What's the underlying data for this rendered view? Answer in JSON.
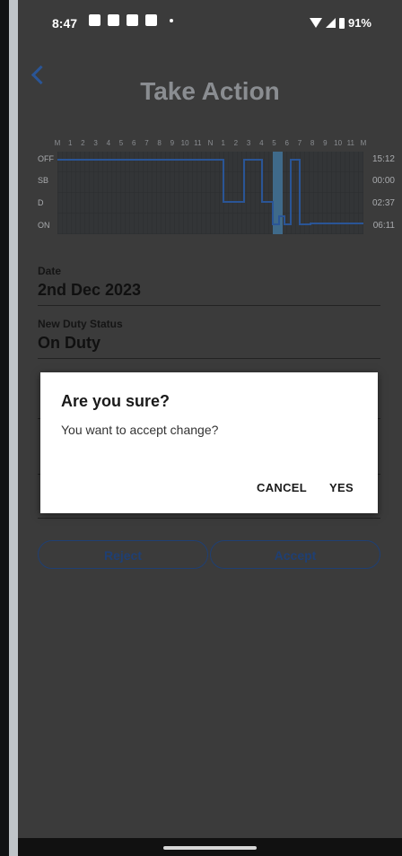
{
  "status_bar": {
    "time": "8:47",
    "battery": "91%",
    "notification_icons": [
      "teams-icon",
      "message-icon",
      "linkedin-icon",
      "nav-icon",
      "dot-icon"
    ]
  },
  "header": {
    "title": "Take Action"
  },
  "log_graph": {
    "hours": [
      "M",
      "1",
      "2",
      "3",
      "4",
      "5",
      "6",
      "7",
      "8",
      "9",
      "10",
      "11",
      "N",
      "1",
      "2",
      "3",
      "4",
      "5",
      "6",
      "7",
      "8",
      "9",
      "10",
      "11",
      "M"
    ],
    "rows": [
      {
        "label": "OFF",
        "total": "15:12"
      },
      {
        "label": "SB",
        "total": "00:00"
      },
      {
        "label": "D",
        "total": "02:37"
      },
      {
        "label": "ON",
        "total": "06:11"
      }
    ],
    "status_line_color": "#2a5596",
    "highlight_color": "#3f6a8a"
  },
  "form": {
    "date_label": "Date",
    "date_value": "2nd Dec 2023",
    "status_label": "New Duty Status",
    "status_value": "On Duty"
  },
  "actions": {
    "reject_label": "Reject",
    "accept_label": "Accept"
  },
  "dialog": {
    "title": "Are you sure?",
    "message": "You want to accept change?",
    "cancel_label": "CANCEL",
    "yes_label": "YES"
  }
}
